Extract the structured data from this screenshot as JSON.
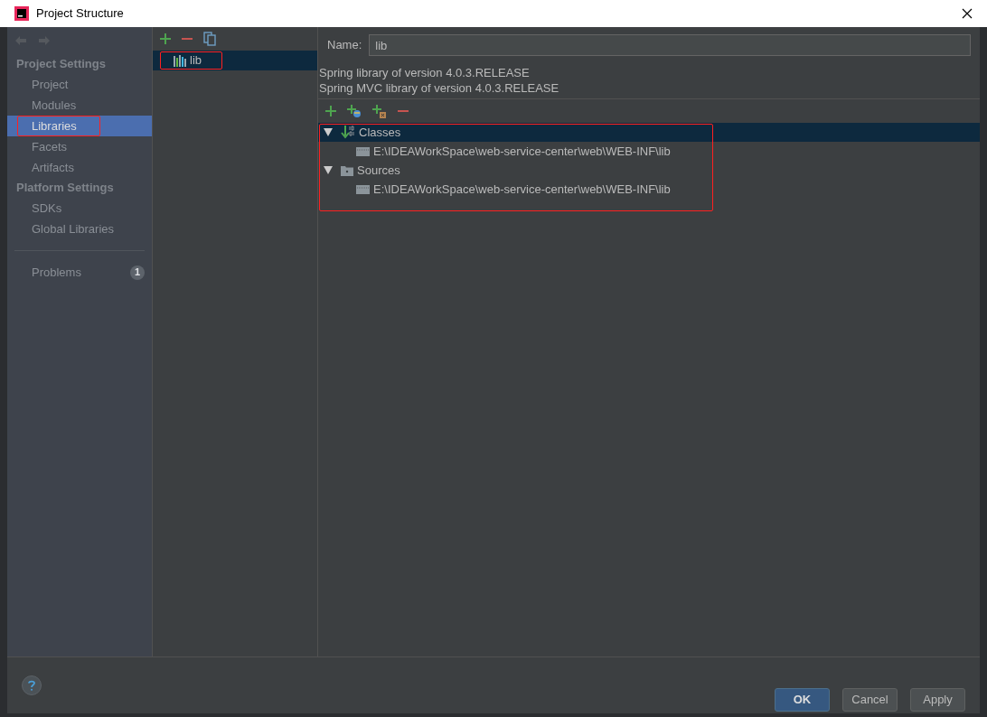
{
  "window": {
    "title": "Project Structure"
  },
  "sidebar": {
    "sections": [
      {
        "heading": "Project Settings",
        "items": [
          {
            "label": "Project",
            "selected": false,
            "annotated": false
          },
          {
            "label": "Modules",
            "selected": false,
            "annotated": false
          },
          {
            "label": "Libraries",
            "selected": true,
            "annotated": true
          },
          {
            "label": "Facets",
            "selected": false,
            "annotated": false
          },
          {
            "label": "Artifacts",
            "selected": false,
            "annotated": false
          }
        ]
      },
      {
        "heading": "Platform Settings",
        "items": [
          {
            "label": "SDKs",
            "selected": false,
            "annotated": false
          },
          {
            "label": "Global Libraries",
            "selected": false,
            "annotated": false
          }
        ]
      }
    ],
    "problems": {
      "label": "Problems",
      "count": "1"
    }
  },
  "libraries": {
    "items": [
      {
        "name": "lib",
        "selected": true,
        "annotated": true
      }
    ]
  },
  "detail": {
    "name_label": "Name:",
    "name_value": "lib",
    "descriptions": [
      "Spring library of version 4.0.3.RELEASE",
      "Spring MVC library of version 4.0.3.RELEASE"
    ],
    "tree": {
      "annotated": true,
      "nodes": [
        {
          "kind": "classes",
          "label": "Classes",
          "expanded": true,
          "selected": true,
          "children": [
            {
              "label": "E:\\IDEAWorkSpace\\web-service-center\\web\\WEB-INF\\lib"
            }
          ]
        },
        {
          "kind": "sources",
          "label": "Sources",
          "expanded": true,
          "selected": false,
          "children": [
            {
              "label": "E:\\IDEAWorkSpace\\web-service-center\\web\\WEB-INF\\lib"
            }
          ]
        }
      ]
    }
  },
  "buttons": [
    {
      "label": "OK",
      "kind": "default"
    },
    {
      "label": "Cancel",
      "kind": "normal"
    },
    {
      "label": "Apply",
      "kind": "normal"
    }
  ]
}
